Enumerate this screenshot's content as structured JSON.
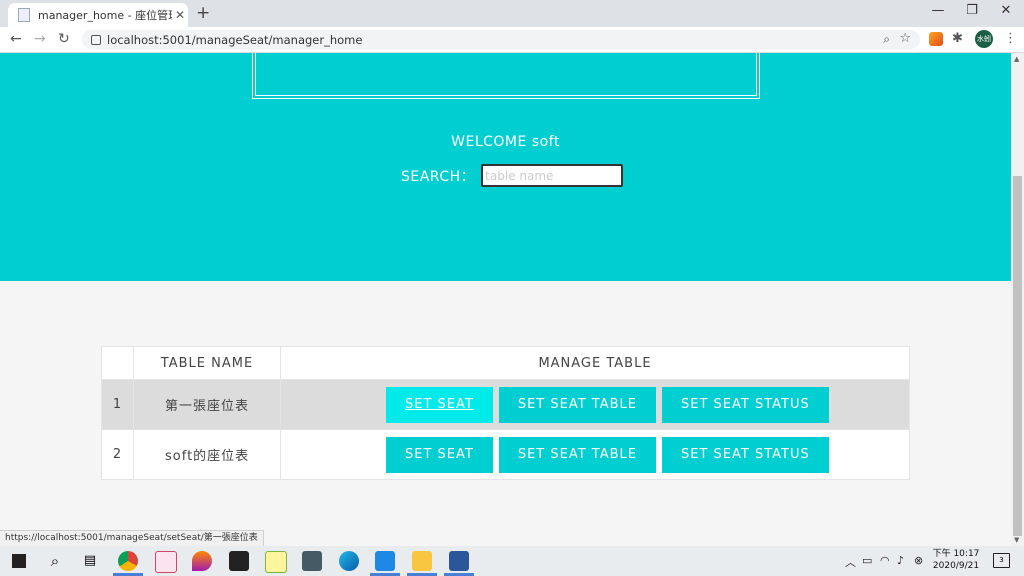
{
  "browser": {
    "tab_title": "manager_home - 座位管理系統",
    "tab_close": "✕",
    "new_tab": "+",
    "window_min": "—",
    "window_restore": "❐",
    "window_close": "✕",
    "url": "localhost:5001/manageSeat/manager_home",
    "profile_label": "水蚓",
    "status_url": "https://localhost:5001/manageSeat/setSeat/第一張座位表"
  },
  "page": {
    "welcome_text": "WELCOME soft",
    "search_label": "SEARCH：",
    "search_placeholder": "table name",
    "search_value": ""
  },
  "table": {
    "headers": {
      "num": "",
      "name": "TABLE NAME",
      "manage": "MANAGE TABLE"
    },
    "rows": [
      {
        "num": "1",
        "name": "第一張座位表",
        "btn1": "SET SEAT",
        "btn2": "SET SEAT TABLE",
        "btn3": "SET SEAT STATUS"
      },
      {
        "num": "2",
        "name": "soft的座位表",
        "btn1": "SET SEAT",
        "btn2": "SET SEAT TABLE",
        "btn3": "SET SEAT STATUS"
      }
    ]
  },
  "taskbar": {
    "clock_line1": "下午 10:17",
    "clock_line2": "2020/9/21",
    "notification_count": "3"
  },
  "colors": {
    "accent": "#00ced1",
    "button_hover": "#00eaea",
    "row_shade": "#dcdcdc"
  }
}
